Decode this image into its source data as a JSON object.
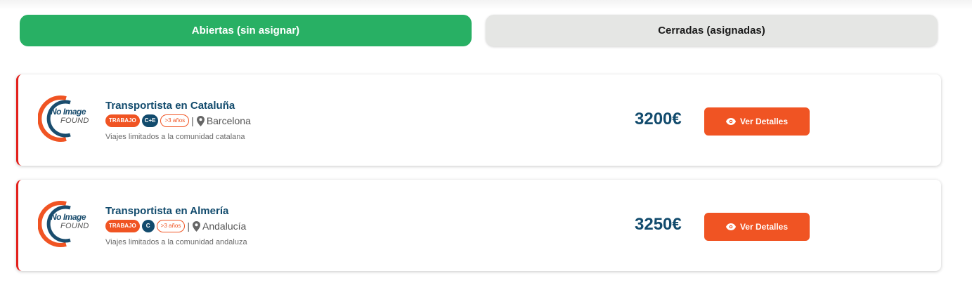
{
  "tabs": [
    {
      "label": "Abiertas (sin asignar)",
      "active": true
    },
    {
      "label": "Cerradas (asignadas)",
      "active": false
    }
  ],
  "colors": {
    "accent_green": "#28b064",
    "accent_orange": "#f05423",
    "accent_red": "#e3201b",
    "navy": "#124b6d"
  },
  "logo": {
    "line1": "No Image",
    "line2": "FOUND"
  },
  "cards": [
    {
      "title": "Transportista en Cataluña",
      "tag_type": "TRABAJO",
      "license": "C+E",
      "experience": ">3 años",
      "separator": "|",
      "location": "Barcelona",
      "location_icon": "map-pin-icon",
      "description": "Viajes limitados a la comunidad catalana",
      "price": "3200€",
      "button_label": "Ver Detalles",
      "button_icon": "eye-icon"
    },
    {
      "title": "Transportista en Almería",
      "tag_type": "TRABAJO",
      "license": "C",
      "experience": ">3 años",
      "separator": "|",
      "location": "Andalucía",
      "location_icon": "map-pin-icon",
      "description": "Viajes limitados a la comunidad andaluza",
      "price": "3250€",
      "button_label": "Ver Detalles",
      "button_icon": "eye-icon"
    }
  ]
}
